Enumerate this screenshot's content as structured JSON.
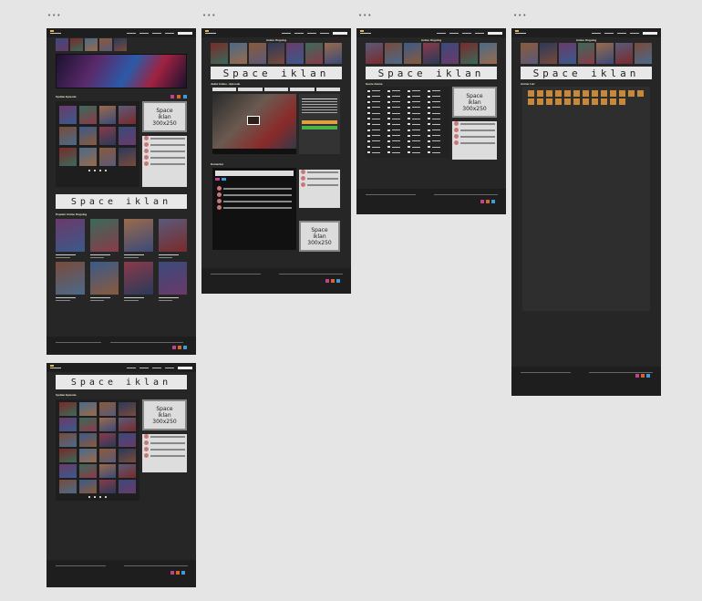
{
  "canvas": {
    "background": "#e5e5e5"
  },
  "frame_markers": [
    "•••",
    "•••",
    "•••",
    "•••",
    "•••"
  ],
  "colors": {
    "frame_bg": "#262626",
    "nav_bg": "#1e1e1e",
    "accent": "#e6b84a",
    "letter_tile": "#c8883a",
    "iklan_bg": "#e8e8e8",
    "poster_palette": [
      "#3a4a7a",
      "#7a2a2a",
      "#4a6a8a",
      "#8a5a3a",
      "#2a3a5a",
      "#6a3a6a",
      "#3a6a5a",
      "#9a6a4a",
      "#5a5a7a",
      "#7a4a3a",
      "#3a5a8a",
      "#8a3a4a"
    ]
  },
  "home": {
    "section_latest": "Update Episode",
    "section_popular": "Populer Anime Ongoing",
    "ad_wide": "Space iklan",
    "ad_small_line1": "Space",
    "ad_small_line2": "iklan",
    "ad_small_line3": "300x250"
  },
  "watch": {
    "title": "Anime Ongoing",
    "ad_wide": "Space iklan",
    "episode_heading": "Judul Anime - Episode",
    "comments_heading": "Komentar",
    "ad_small_line1": "Space",
    "ad_small_line2": "iklan",
    "ad_small_line3": "300x250"
  },
  "genre": {
    "title": "Anime Ongoing",
    "ad_wide": "Space iklan",
    "list_heading": "Genre Anime",
    "ad_small_line1": "Space",
    "ad_small_line2": "iklan",
    "ad_small_line3": "300x250"
  },
  "list": {
    "title": "Anime Ongoing",
    "ad_wide": "Space iklan",
    "list_heading": "Anime List"
  },
  "latest": {
    "ad_wide": "Space iklan",
    "section_latest": "Update Episode",
    "ad_small_line1": "Space",
    "ad_small_line2": "iklan",
    "ad_small_line3": "300x250"
  }
}
